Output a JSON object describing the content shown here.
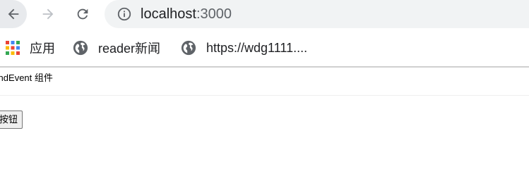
{
  "browser": {
    "url_host": "localhost",
    "url_port": ":3000",
    "bookmarks": [
      {
        "label": "应用",
        "icon": "apps-grid-icon"
      },
      {
        "label": "reader新闻",
        "icon": "globe-icon"
      },
      {
        "label": "https://wdg1111....",
        "icon": "globe-icon"
      }
    ]
  },
  "page": {
    "component_title": "BindEvent 组件",
    "button_label": "按钮"
  }
}
